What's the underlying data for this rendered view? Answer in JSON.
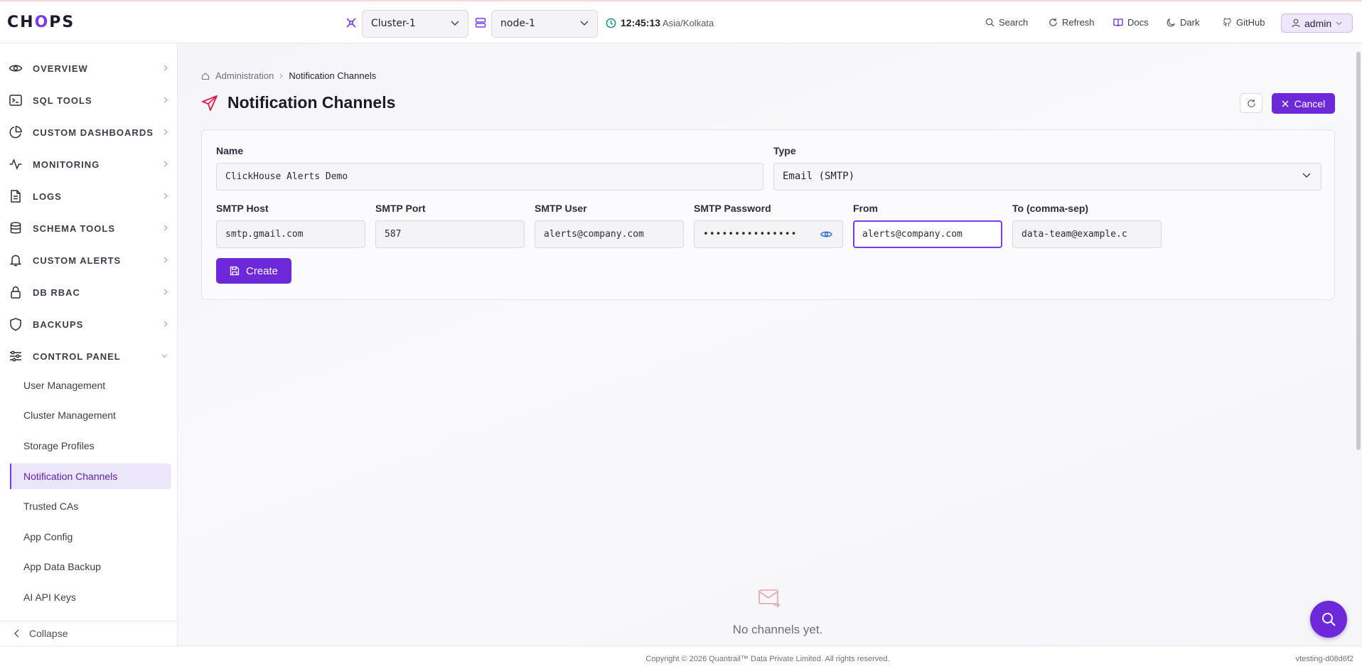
{
  "app": {
    "logo_pre": "CH",
    "logo_o": "O",
    "logo_post": "PS"
  },
  "topbar": {
    "cluster": "Cluster-1",
    "node": "node-1",
    "time": "12:45:13",
    "timezone": "Asia/Kolkata",
    "links": {
      "search": "Search",
      "refresh": "Refresh",
      "docs": "Docs",
      "theme": "Dark",
      "github": "GitHub"
    },
    "user": "admin"
  },
  "sidebar": {
    "items": [
      {
        "label": "OVERVIEW",
        "icon": "eye-icon"
      },
      {
        "label": "SQL TOOLS",
        "icon": "terminal-icon"
      },
      {
        "label": "CUSTOM DASHBOARDS",
        "icon": "pie-chart-icon"
      },
      {
        "label": "MONITORING",
        "icon": "activity-icon"
      },
      {
        "label": "LOGS",
        "icon": "file-text-icon"
      },
      {
        "label": "SCHEMA TOOLS",
        "icon": "database-icon"
      },
      {
        "label": "CUSTOM ALERTS",
        "icon": "bell-icon"
      },
      {
        "label": "DB RBAC",
        "icon": "lock-icon"
      },
      {
        "label": "BACKUPS",
        "icon": "shield-icon"
      },
      {
        "label": "CONTROL PANEL",
        "icon": "sliders-icon"
      }
    ],
    "sub_items": [
      "User Management",
      "Cluster Management",
      "Storage Profiles",
      "Notification Channels",
      "Trusted CAs",
      "App Config",
      "App Data Backup",
      "AI API Keys"
    ],
    "collapse": "Collapse"
  },
  "main": {
    "breadcrumb": {
      "parent": "Administration",
      "current": "Notification Channels"
    },
    "title": "Notification Channels",
    "cancel": "Cancel",
    "form": {
      "name_label": "Name",
      "name_value": "ClickHouse Alerts Demo",
      "type_label": "Type",
      "type_value": "Email (SMTP)",
      "smtp_host_label": "SMTP Host",
      "smtp_host_value": "smtp.gmail.com",
      "smtp_port_label": "SMTP Port",
      "smtp_port_value": "587",
      "smtp_user_label": "SMTP User",
      "smtp_user_value": "alerts@company.com",
      "smtp_password_label": "SMTP Password",
      "smtp_password_value": "•••••••••••••••",
      "from_label": "From",
      "from_value": "alerts@company.com",
      "to_label": "To (comma-sep)",
      "to_value": "data-team@example.c",
      "create": "Create"
    },
    "empty": "No channels yet."
  },
  "footer": {
    "copyright": "Copyright © 2026 Quantrail™ Data Private Limited. All rights reserved.",
    "version": "vtesting-d08d6f2"
  },
  "colors": {
    "accent": "#6d28d9",
    "active_bg": "#ece6fb",
    "title_icon": "#e11d48"
  }
}
